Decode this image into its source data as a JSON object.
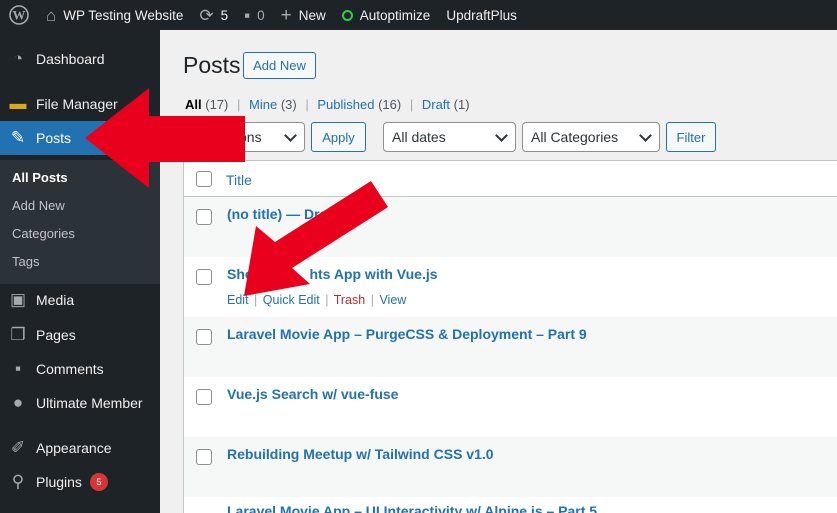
{
  "adminbar": {
    "site_name": "WP Testing Website",
    "updates_count": "5",
    "comments_count": "0",
    "new_label": "New",
    "autoptimize_label": "Autoptimize",
    "updraft_label": "UpdraftPlus"
  },
  "sidebar": {
    "items": [
      {
        "label": "Dashboard",
        "icon": "dashboard-icon"
      },
      {
        "label": "File Manager",
        "icon": "folder-icon"
      },
      {
        "label": "Posts",
        "icon": "pin-icon"
      },
      {
        "label": "Media",
        "icon": "media-icon"
      },
      {
        "label": "Pages",
        "icon": "pages-icon"
      },
      {
        "label": "Comments",
        "icon": "comment-icon"
      },
      {
        "label": "Ultimate Member",
        "icon": "user-icon"
      },
      {
        "label": "Appearance",
        "icon": "brush-icon"
      },
      {
        "label": "Plugins",
        "icon": "plugin-icon",
        "badge": "5"
      }
    ],
    "submenu": [
      "All Posts",
      "Add New",
      "Categories",
      "Tags"
    ]
  },
  "page": {
    "title": "Posts",
    "add_new": "Add New"
  },
  "filters_links": {
    "all": "All",
    "all_count": "(17)",
    "mine": "Mine",
    "mine_count": "(3)",
    "published": "Published",
    "published_count": "(16)",
    "draft": "Draft",
    "draft_count": "(1)"
  },
  "toolbar": {
    "bulk_actions_visible": "ons",
    "apply": "Apply",
    "dates": "All dates",
    "categories": "All Categories",
    "filter": "Filter"
  },
  "table": {
    "header_title": "Title",
    "rows": [
      {
        "title": "(no title) — Dra"
      },
      {
        "title": "Sho",
        "title_end": "hts App with Vue.js"
      },
      {
        "title": "Laravel Movie App – PurgeCSS & Deployment – Part 9"
      },
      {
        "title": "Vue.js Search w/ vue-fuse"
      },
      {
        "title": "Rebuilding Meetup w/ Tailwind CSS v1.0"
      },
      {
        "title": "Laravel Movie App – UI Interactivity w/ Alpine.js – Part 5"
      }
    ],
    "row_actions": {
      "edit": "Edit",
      "quick_edit": "Quick Edit",
      "trash": "Trash",
      "view": "View"
    }
  },
  "colors": {
    "admin_dark": "#1d2327",
    "accent": "#2271b1",
    "arrow_red": "#e8001c",
    "badge_red": "#d63638"
  }
}
